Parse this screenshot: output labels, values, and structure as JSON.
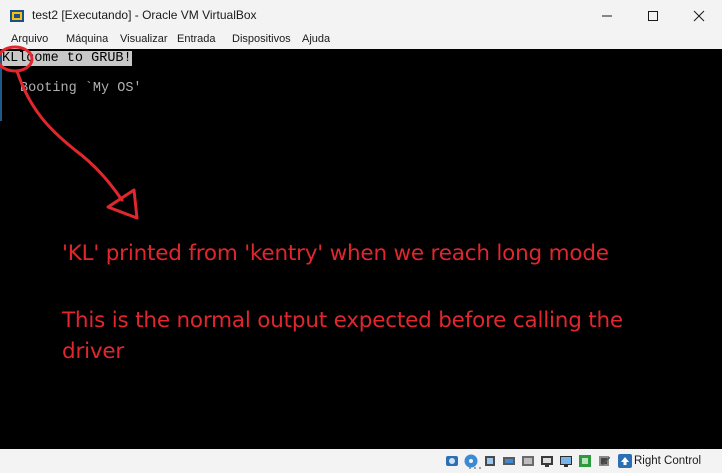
{
  "window": {
    "title": "test2 [Executando] - Oracle VM VirtualBox",
    "minimize_icon": "minimize-icon",
    "maximize_icon": "maximize-icon",
    "close_icon": "close-icon"
  },
  "menu": {
    "items": [
      "Arquivo",
      "Máquina",
      "Visualizar",
      "Entrada",
      "Dispositivos",
      "Ajuda"
    ]
  },
  "console": {
    "kl": "KL",
    "welcome_rest": "lcome to GRUB!",
    "boot_line": "Booting `My OS'"
  },
  "annotations": {
    "line1": "'KL' printed from 'kentry' when we reach long mode",
    "line2": "This is the normal output expected before calling the",
    "line3": "driver",
    "color": "#e1262d"
  },
  "statusbar": {
    "host_key": "Right Control",
    "icons": [
      "hard-disk-icon",
      "optical-drive-icon",
      "audio-icon",
      "network-icon",
      "usb-icon",
      "shared-folders-icon",
      "display-icon",
      "video-capture-icon",
      "cpu-icon",
      "mouse-integration-icon",
      "keyboard-arrow-icon"
    ]
  },
  "colors": {
    "chrome": "#f3f3f3",
    "screen": "#000000",
    "annotation": "#e1262d"
  }
}
